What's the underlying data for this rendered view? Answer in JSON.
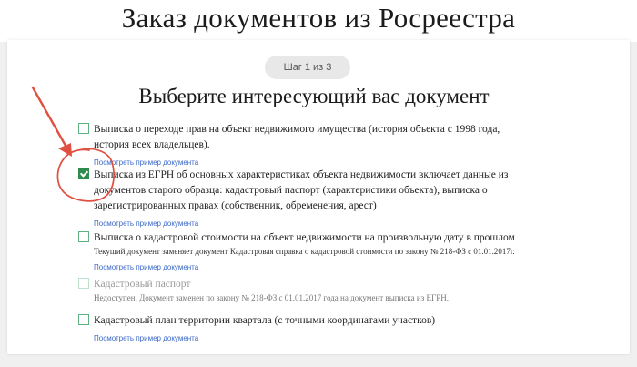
{
  "page": {
    "title": "Заказ документов из Росреестра"
  },
  "stepper": {
    "label": "Шаг 1 из 3"
  },
  "section": {
    "title": "Выберите интересующий вас документ"
  },
  "options": [
    {
      "label": "Выписка о переходе прав на объект недвижимого имущества (история объекта с 1998 года, история всех владельцев).",
      "note": "",
      "link": "Посмотреть пример документа",
      "checked": false
    },
    {
      "label": "Выписка из ЕГРН об основных характеристиках объекта недвижимости включает данные из документов старого образца: кадастровый паспорт (характеристики объекта), выписка о зарегистрированных правах (собственник, обременения, арест)",
      "note": "",
      "link": "Посмотреть пример документа",
      "checked": true
    },
    {
      "label": "Выписка о кадастровой стоимости на объект недвижимости на произвольную дату в прошлом",
      "note": "Текущий документ заменяет документ Кадастровая справка о кадастровой стоимости по закону № 218-ФЗ с 01.01.2017г.",
      "link": "Посмотреть пример документа",
      "checked": false
    },
    {
      "label": "Кадастровый паспорт",
      "note": "Недоступен. Документ заменен по закону № 218-ФЗ с 01.01.2017 года на документ выписка из ЕГРН.",
      "link": "",
      "checked": false,
      "disabled": true
    },
    {
      "label": "Кадастровый план территории квартала (с точными координатами участков)",
      "note": "",
      "link": "Посмотреть пример документа",
      "checked": false
    }
  ],
  "colors": {
    "accent": "#2e8a4d",
    "link": "#3b69c7",
    "annotation": "#e05040"
  },
  "icons": {
    "annotation_arrow": "red-arrow-icon",
    "annotation_circle": "red-circle-icon"
  }
}
